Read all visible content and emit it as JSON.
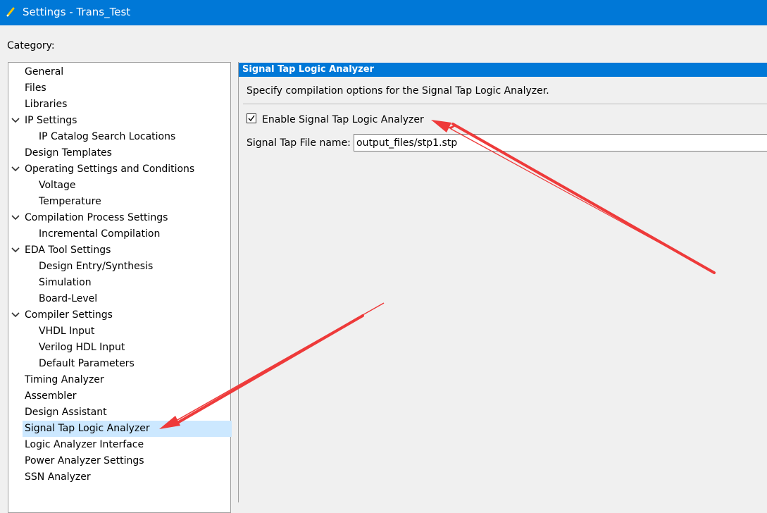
{
  "window": {
    "title": "Settings - Trans_Test"
  },
  "category_label": "Category:",
  "tree": {
    "items": [
      {
        "label": "General",
        "level": 0,
        "expanded": false,
        "selected": false
      },
      {
        "label": "Files",
        "level": 0,
        "expanded": false,
        "selected": false
      },
      {
        "label": "Libraries",
        "level": 0,
        "expanded": false,
        "selected": false
      },
      {
        "label": "IP Settings",
        "level": 0,
        "expanded": true,
        "selected": false
      },
      {
        "label": "IP Catalog Search Locations",
        "level": 1,
        "expanded": false,
        "selected": false
      },
      {
        "label": "Design Templates",
        "level": 0,
        "expanded": false,
        "selected": false
      },
      {
        "label": "Operating Settings and Conditions",
        "level": 0,
        "expanded": true,
        "selected": false
      },
      {
        "label": "Voltage",
        "level": 1,
        "expanded": false,
        "selected": false
      },
      {
        "label": "Temperature",
        "level": 1,
        "expanded": false,
        "selected": false
      },
      {
        "label": "Compilation Process Settings",
        "level": 0,
        "expanded": true,
        "selected": false
      },
      {
        "label": "Incremental Compilation",
        "level": 1,
        "expanded": false,
        "selected": false
      },
      {
        "label": "EDA Tool Settings",
        "level": 0,
        "expanded": true,
        "selected": false
      },
      {
        "label": "Design Entry/Synthesis",
        "level": 1,
        "expanded": false,
        "selected": false
      },
      {
        "label": "Simulation",
        "level": 1,
        "expanded": false,
        "selected": false
      },
      {
        "label": "Board-Level",
        "level": 1,
        "expanded": false,
        "selected": false
      },
      {
        "label": "Compiler Settings",
        "level": 0,
        "expanded": true,
        "selected": false
      },
      {
        "label": "VHDL Input",
        "level": 1,
        "expanded": false,
        "selected": false
      },
      {
        "label": "Verilog HDL Input",
        "level": 1,
        "expanded": false,
        "selected": false
      },
      {
        "label": "Default Parameters",
        "level": 1,
        "expanded": false,
        "selected": false
      },
      {
        "label": "Timing Analyzer",
        "level": 0,
        "expanded": false,
        "selected": false
      },
      {
        "label": "Assembler",
        "level": 0,
        "expanded": false,
        "selected": false
      },
      {
        "label": "Design Assistant",
        "level": 0,
        "expanded": false,
        "selected": false
      },
      {
        "label": "Signal Tap Logic Analyzer",
        "level": 0,
        "expanded": false,
        "selected": true
      },
      {
        "label": "Logic Analyzer Interface",
        "level": 0,
        "expanded": false,
        "selected": false
      },
      {
        "label": "Power Analyzer Settings",
        "level": 0,
        "expanded": false,
        "selected": false
      },
      {
        "label": "SSN Analyzer",
        "level": 0,
        "expanded": false,
        "selected": false
      }
    ]
  },
  "panel": {
    "header": "Signal Tap Logic Analyzer",
    "description": "Specify compilation options for the Signal Tap Logic Analyzer.",
    "enable_checkbox": {
      "label": "Enable Signal Tap Logic Analyzer",
      "checked": true
    },
    "file_name": {
      "label": "Signal Tap File name:",
      "value": "output_files/stp1.stp"
    }
  },
  "colors": {
    "titlebar": "#0078d7",
    "panel_header": "#0078d7",
    "selection": "#cce8ff",
    "annotation_arrow": "#ee3a3a"
  },
  "icons": {
    "window": "pencil-icon",
    "expand": "chevron-down-icon",
    "check": "checkmark-icon"
  }
}
